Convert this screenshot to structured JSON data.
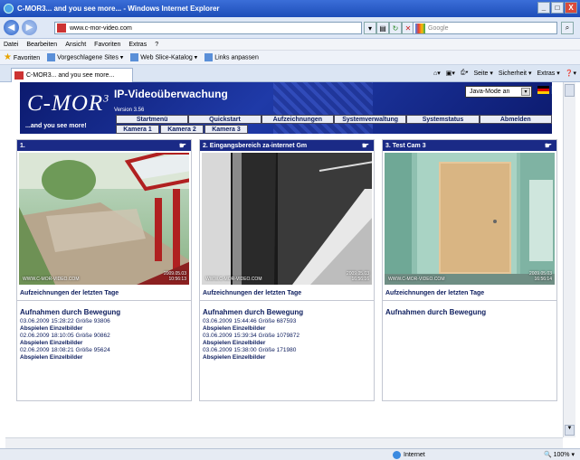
{
  "window": {
    "title": "C-MOR3... and you see more... - Windows Internet Explorer",
    "min": "_",
    "max": "□",
    "close": "X"
  },
  "addressbar": {
    "url": "www.c-mor-video.com",
    "search_placeholder": "Google"
  },
  "menubar": [
    "Datei",
    "Bearbeiten",
    "Ansicht",
    "Favoriten",
    "Extras",
    "?"
  ],
  "favbar": {
    "favorites": "Favoriten",
    "suggested": "Vorgeschlagene Sites ▾",
    "webslice": "Web Slice-Katalog ▾",
    "links": "Links anpassen"
  },
  "tab": {
    "label": "C-MOR3... and you see more..."
  },
  "cmdbar": [
    "Seite ▾",
    "Sicherheit ▾",
    "Extras ▾"
  ],
  "statusbar": {
    "zone": "Internet",
    "zoom": "100%"
  },
  "app": {
    "logo": "C-MOR",
    "logo_sup": "3",
    "tagline": "...and you see more!",
    "title": "IP-Videoüberwachung",
    "version": "Version 3.56",
    "java_mode": "Java-Mode an",
    "nav": [
      "Startmenü",
      "Quickstart",
      "Aufzeichnungen",
      "Systemverwaltung",
      "Systemstatus",
      "Abmelden"
    ],
    "cam_tabs": [
      "Kamera 1",
      "Kamera 2",
      "Kamera 3"
    ]
  },
  "cameras": [
    {
      "title": "1.",
      "recordings_label": "Aufzeichnungen der letzten Tage",
      "watermark": "WWW.C-MOR-VIDEO.COM",
      "ts1": "2009.05.03",
      "ts2": "10:56:13",
      "motion_title": "Aufnahmen durch Bewegung",
      "events": [
        {
          "line": "03.06.2009 15:28:22 Größe 93806",
          "action": "Abspielen Einzelbilder"
        },
        {
          "line": "02.06.2009 18:10:05 Größe 90862",
          "action": "Abspielen Einzelbilder"
        },
        {
          "line": "02.06.2009 18:08:21 Größe 95624",
          "action": "Abspielen Einzelbilder"
        }
      ]
    },
    {
      "title": "2. Eingangsbereich za-internet Gm",
      "recordings_label": "Aufzeichnungen der letzten Tage",
      "watermark": "WWW.C-MOR-VIDEO.COM",
      "ts1": "2009.05.03",
      "ts2": "16:56:16",
      "motion_title": "Aufnahmen durch Bewegung",
      "events": [
        {
          "line": "03.06.2009 15:44:46 Größe 687593",
          "action": "Abspielen Einzelbilder"
        },
        {
          "line": "03.06.2009 15:39:34 Größe 1079872",
          "action": "Abspielen Einzelbilder"
        },
        {
          "line": "03.06.2009 15:38:00 Größe 171980",
          "action": "Abspielen Einzelbilder"
        }
      ]
    },
    {
      "title": "3. Test Cam 3",
      "recordings_label": "Aufzeichnungen der letzten Tage",
      "watermark": "WWW.C-MOR-VIDEO.COM",
      "ts1": "2009.05.03",
      "ts2": "16:56:14",
      "motion_title": "Aufnahmen durch Bewegung",
      "events": []
    }
  ]
}
